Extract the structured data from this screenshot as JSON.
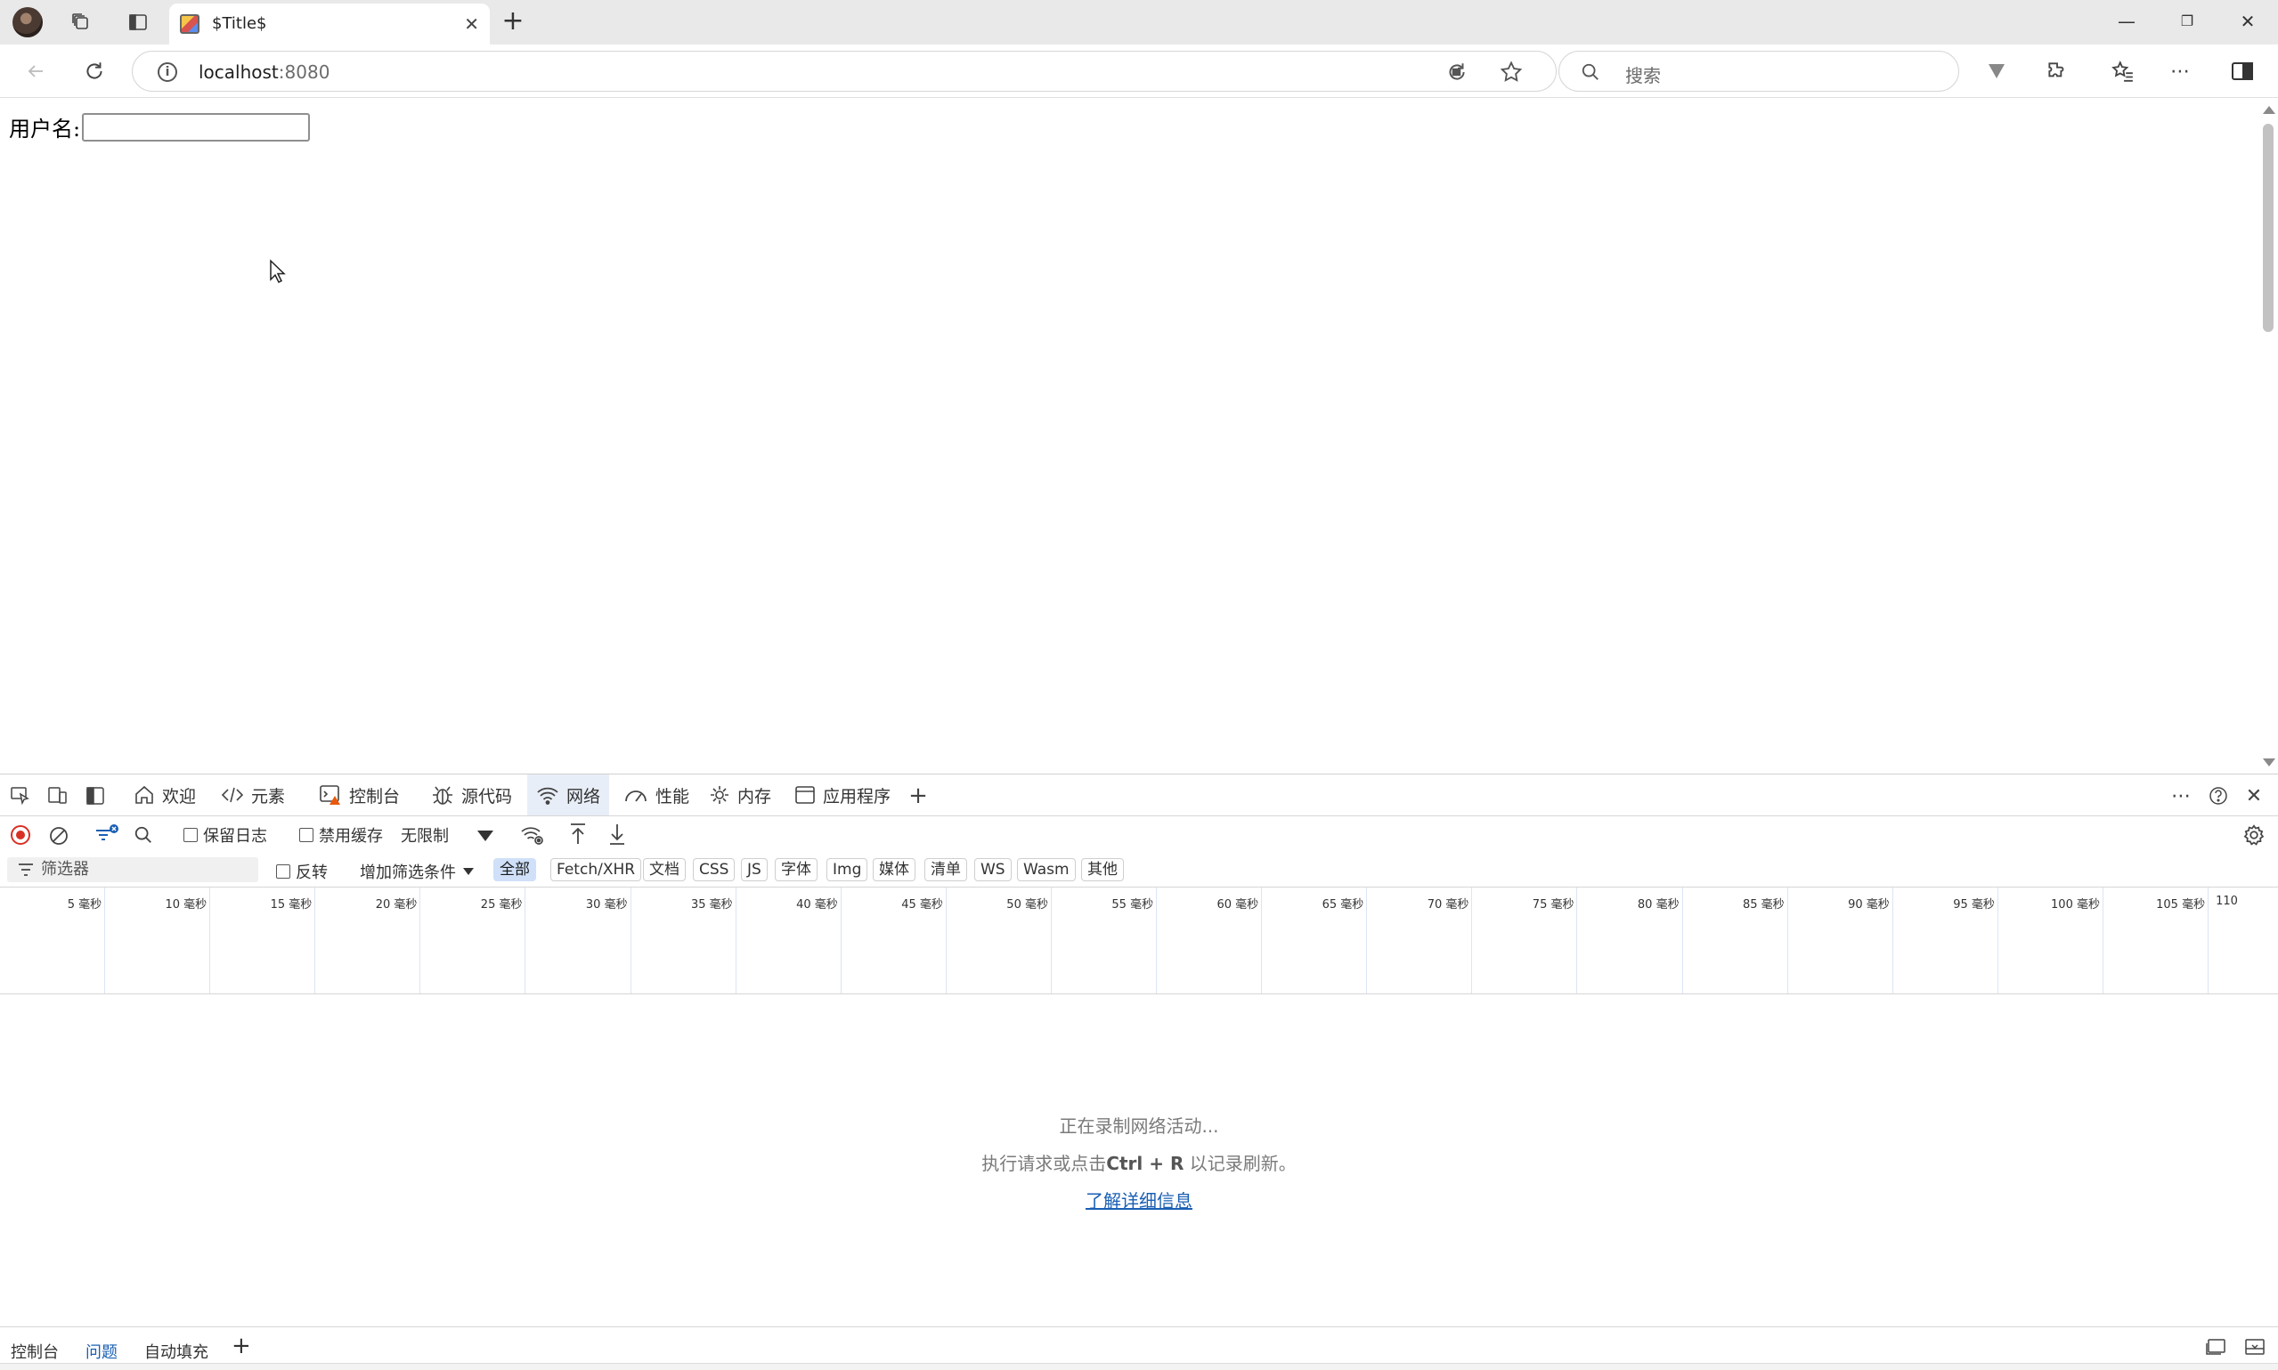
{
  "browser": {
    "tab_title": "$Title$",
    "address": {
      "host": "localhost",
      "port": ":8080"
    },
    "search_placeholder": "搜索"
  },
  "page": {
    "username_label": "用户名:",
    "username_value": ""
  },
  "devtools": {
    "tabs": [
      "欢迎",
      "元素",
      "控制台",
      "源代码",
      "网络",
      "性能",
      "内存",
      "应用程序"
    ],
    "active_tab": "网络",
    "toolbar": {
      "preserve_log": "保留日志",
      "disable_cache": "禁用缓存",
      "throttle": "无限制"
    },
    "filter": {
      "placeholder": "筛选器",
      "invert": "反转",
      "more_filters": "增加筛选条件",
      "types": [
        "全部",
        "Fetch/XHR",
        "文档",
        "CSS",
        "JS",
        "字体",
        "Img",
        "媒体",
        "清单",
        "WS",
        "Wasm",
        "其他"
      ],
      "active_type": "全部"
    },
    "timeline_ticks": [
      "5 毫秒",
      "10 毫秒",
      "15 毫秒",
      "20 毫秒",
      "25 毫秒",
      "30 毫秒",
      "35 毫秒",
      "40 毫秒",
      "45 毫秒",
      "50 毫秒",
      "55 毫秒",
      "60 毫秒",
      "65 毫秒",
      "70 毫秒",
      "75 毫秒",
      "80 毫秒",
      "85 毫秒",
      "90 毫秒",
      "95 毫秒",
      "100 毫秒",
      "105 毫秒",
      "110"
    ],
    "empty_state": {
      "line1": "正在录制网络活动...",
      "line2_pre": "执行请求或点击",
      "line2_key": "Ctrl + R",
      "line2_post": " 以记录刷新。",
      "link": "了解详细信息"
    },
    "drawer_tabs": [
      "控制台",
      "问题",
      "自动填充"
    ],
    "drawer_active": "问题"
  },
  "colors": {
    "accent": "#1a5fb4",
    "record_red": "#d93025",
    "active_chip": "#cfe0f8"
  }
}
